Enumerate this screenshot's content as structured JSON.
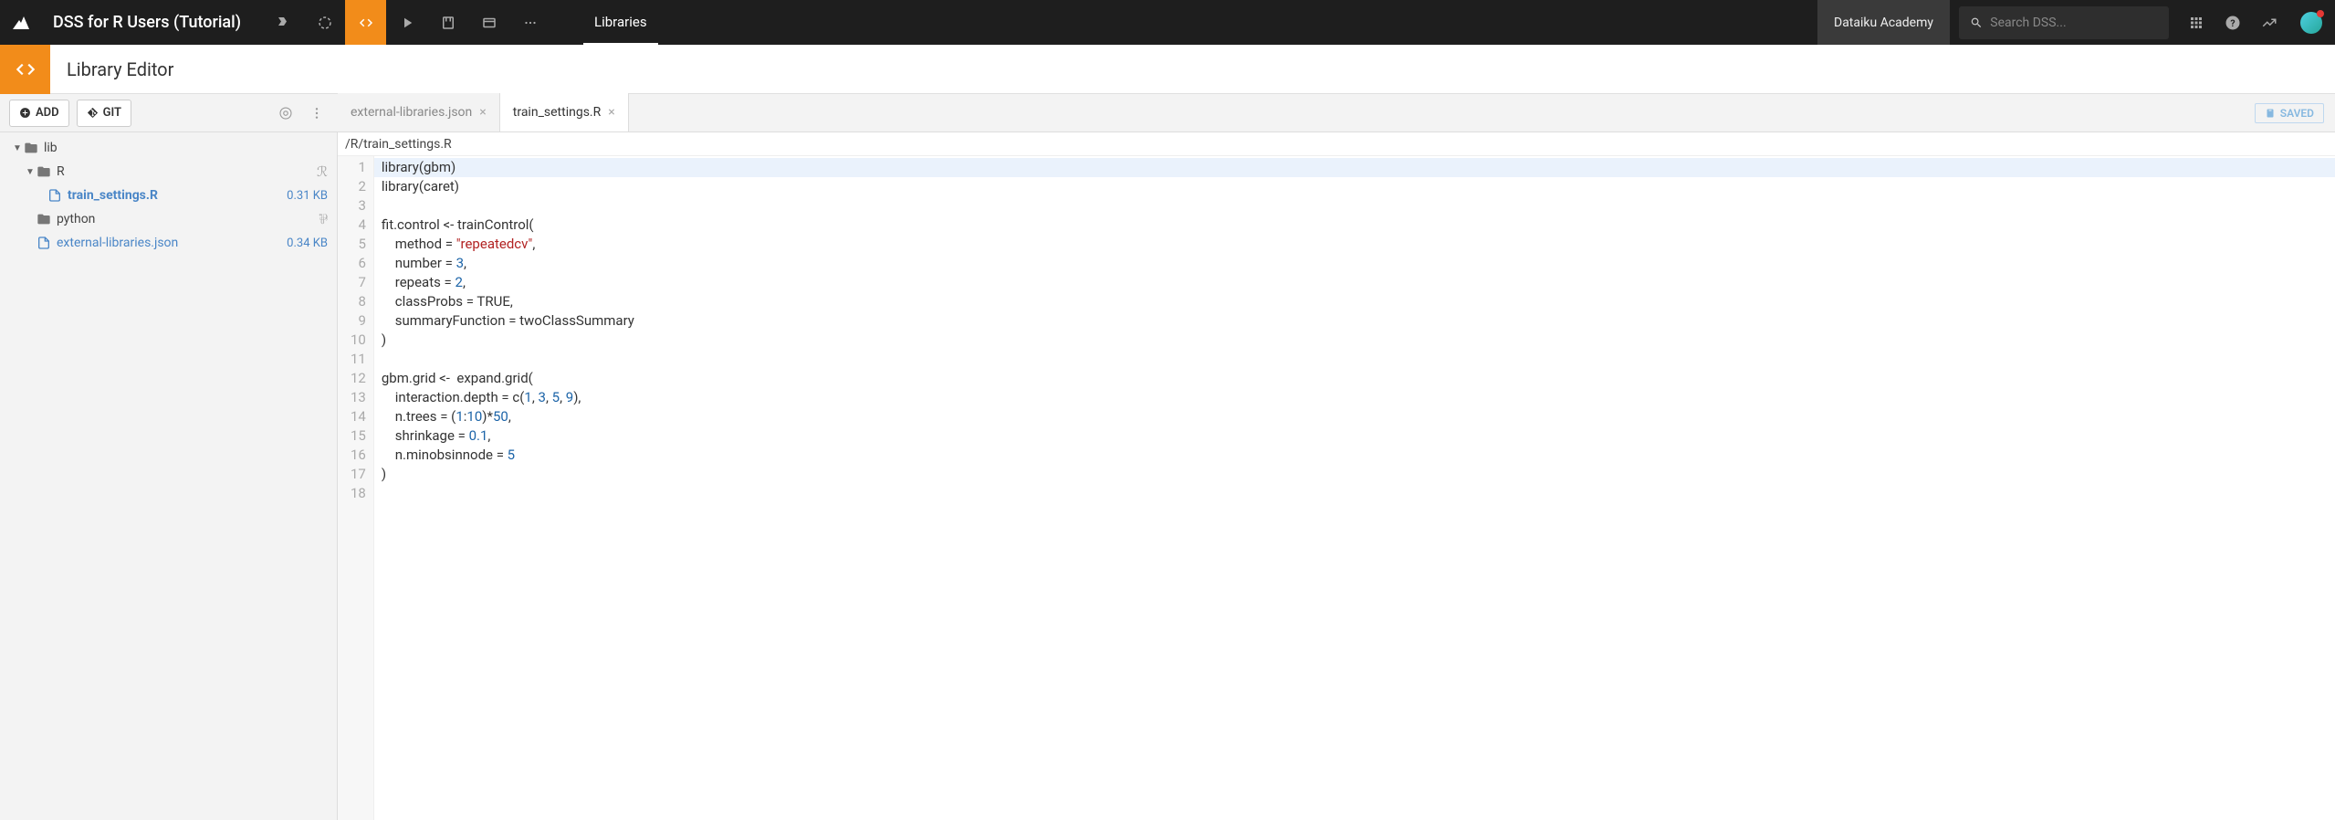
{
  "header": {
    "project_name": "DSS for R Users (Tutorial)",
    "current_page": "Libraries",
    "academy_label": "Dataiku Academy",
    "search_placeholder": "Search DSS..."
  },
  "subheader": {
    "title": "Library Editor"
  },
  "toolbar": {
    "add_label": "ADD",
    "git_label": "GIT",
    "saved_label": "SAVED",
    "tabs": [
      {
        "label": "external-libraries.json",
        "active": false
      },
      {
        "label": "train_settings.R",
        "active": true
      }
    ]
  },
  "sidebar": {
    "tree": {
      "root_label": "lib",
      "items": [
        {
          "label": "R",
          "type": "folder",
          "lang_icon": "R",
          "depth": 1
        },
        {
          "label": "train_settings.R",
          "type": "file",
          "size": "0.31 KB",
          "active": true,
          "depth": 2
        },
        {
          "label": "python",
          "type": "folder",
          "lang_icon": "py",
          "depth": 1
        },
        {
          "label": "external-libraries.json",
          "type": "file",
          "size": "0.34 KB",
          "depth": 1
        }
      ]
    }
  },
  "editor": {
    "filepath": "/R/train_settings.R",
    "line_count": 18,
    "code_lines": [
      "library(gbm)",
      "library(caret)",
      "",
      "fit.control <- trainControl(",
      "    method = \"repeatedcv\",",
      "    number = 3,",
      "    repeats = 2,",
      "    classProbs = TRUE,",
      "    summaryFunction = twoClassSummary",
      ")",
      "",
      "gbm.grid <-  expand.grid(",
      "    interaction.depth = c(1, 3, 5, 9),",
      "    n.trees = (1:10)*50,",
      "    shrinkage = 0.1,",
      "    n.minobsinnode = 5",
      ")",
      ""
    ]
  }
}
